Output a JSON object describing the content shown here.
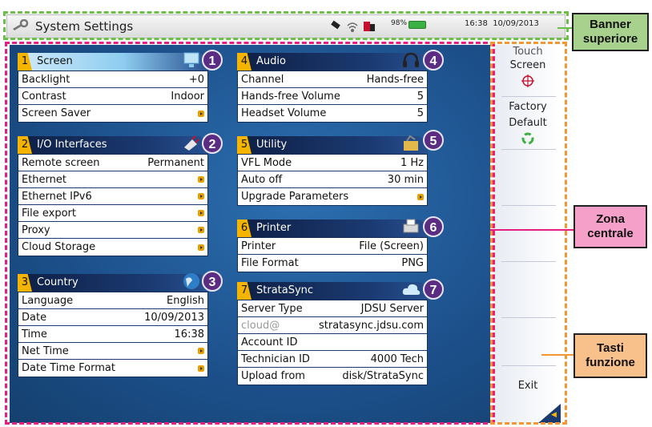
{
  "banner": {
    "title": "System Settings",
    "battery_percent": "98%",
    "battery_level": 0.98,
    "time": "16:38",
    "date": "10/09/2013"
  },
  "panels": [
    {
      "num": "1",
      "title": "Screen",
      "icon": "monitor-icon",
      "rows": [
        {
          "label": "Backlight",
          "value": "+0"
        },
        {
          "label": "Contrast",
          "value": "Indoor"
        },
        {
          "label": "Screen Saver",
          "value": ""
        }
      ]
    },
    {
      "num": "2",
      "title": "I/O Interfaces",
      "icon": "plug-icon",
      "rows": [
        {
          "label": "Remote screen",
          "value": "Permanent"
        },
        {
          "label": "Ethernet",
          "value": ""
        },
        {
          "label": "Ethernet IPv6",
          "value": ""
        },
        {
          "label": "File export",
          "value": ""
        },
        {
          "label": "Proxy",
          "value": ""
        },
        {
          "label": "Cloud Storage",
          "value": ""
        }
      ]
    },
    {
      "num": "3",
      "title": "Country",
      "icon": "globe-icon",
      "rows": [
        {
          "label": "Language",
          "value": "English"
        },
        {
          "label": "Date",
          "value": "10/09/2013"
        },
        {
          "label": "Time",
          "value": "16:38"
        },
        {
          "label": "Net Time",
          "value": ""
        },
        {
          "label": "Date Time Format",
          "value": ""
        }
      ]
    },
    {
      "num": "4",
      "title": "Audio",
      "icon": "headphones-icon",
      "rows": [
        {
          "label": "Channel",
          "value": "Hands-free"
        },
        {
          "label": "Hands-free Volume",
          "value": "5"
        },
        {
          "label": "Headset Volume",
          "value": "5"
        }
      ]
    },
    {
      "num": "5",
      "title": "Utility",
      "icon": "toolbox-icon",
      "rows": [
        {
          "label": "VFL Mode",
          "value": "1 Hz"
        },
        {
          "label": "Auto off",
          "value": "30 min"
        },
        {
          "label": "Upgrade Parameters",
          "value": ""
        }
      ]
    },
    {
      "num": "6",
      "title": "Printer",
      "icon": "printer-icon",
      "rows": [
        {
          "label": "Printer",
          "value": "File (Screen)"
        },
        {
          "label": "File Format",
          "value": "PNG"
        }
      ]
    },
    {
      "num": "7",
      "title": "StrataSync",
      "icon": "cloud-icon",
      "rows": [
        {
          "label": "Server Type",
          "value": "JDSU Server"
        },
        {
          "label": "cloud@",
          "value": "stratasync.jdsu.com"
        },
        {
          "label": "Account ID",
          "value": ""
        },
        {
          "label": "Technician ID",
          "value": "4000 Tech"
        },
        {
          "label": "Upload from",
          "value": "disk/StrataSync"
        }
      ]
    }
  ],
  "fkeys": {
    "touch_line1": "Touch",
    "touch_line2": "Screen",
    "factory_line1": "Factory",
    "factory_line2": "Default",
    "exit": "Exit"
  },
  "annotations": {
    "banner": "Banner superiore",
    "central": "Zona centrale",
    "fkeys": "Tasti funzione"
  },
  "colors": {
    "banner_frame": "#6cc04a",
    "central_frame": "#e51f7f",
    "fkeys_frame": "#f39633",
    "badge": "#5a2d82",
    "panel_number": "#f4b400"
  }
}
